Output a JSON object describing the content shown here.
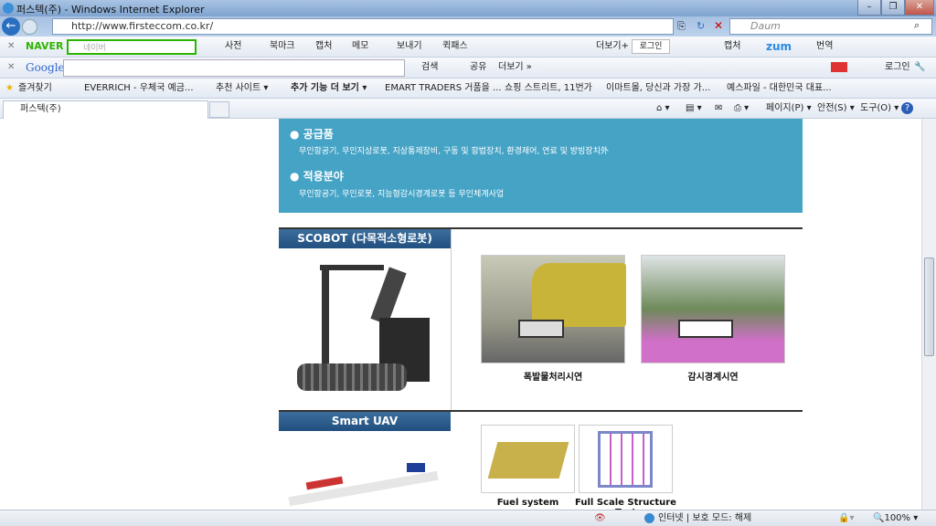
{
  "window": {
    "title": "퍼스텍(주) - Windows Internet Explorer"
  },
  "address": {
    "url": "http://www.firsteccom.co.kr/",
    "search_placeholder": "Daum"
  },
  "naver": {
    "logo": "NAVER",
    "search_placeholder": "네이버",
    "items": [
      "사전",
      "북마크",
      "캡처",
      "메모",
      "보내기",
      "퀵패스"
    ],
    "more": "더보기+",
    "login": "로그인",
    "capture": "캡처",
    "zum": "zum",
    "translate": "번역"
  },
  "google": {
    "logo": "Google",
    "search": "검색",
    "share": "공유",
    "more": "더보기 »",
    "login": "로그인"
  },
  "favorites": {
    "label": "즐겨찾기",
    "items": [
      "EVERRICH - 우체국 예금...",
      "추천 사이트 ▾",
      "추가 기능 더 보기 ▾",
      "EMART TRADERS 거품을 ...",
      "쇼핑 스트리트, 11번가",
      "이마트몰, 당신과 가장 가...",
      "예스파일 - 대한민국 대표..."
    ]
  },
  "tab": {
    "label": "퍼스텍(주)"
  },
  "command_bar": {
    "page": "페이지(P) ▾",
    "safety": "안전(S) ▾",
    "tools": "도구(O) ▾"
  },
  "content": {
    "supply_title": "공급품",
    "supply_text": "무인항공기, 무인지상로봇, 지상통제장비, 구동 및 항법장치, 환경제어, 연료 및 방빙장치外",
    "apply_title": "적용분야",
    "apply_text": "무인항공기, 무인로봇, 지능형감시경계로봇 등 무인체계사업",
    "scobot": {
      "title": "SCOBOT (다목적소형로봇)",
      "captions": [
        "폭발물처리시연",
        "감시경계시연"
      ]
    },
    "uav": {
      "title": "Smart UAV",
      "captions": [
        "Fuel system",
        "Full Scale Structure Test"
      ]
    }
  },
  "status": {
    "zone": "인터넷 | 보호 모드: 해제",
    "zoom": "100%"
  }
}
